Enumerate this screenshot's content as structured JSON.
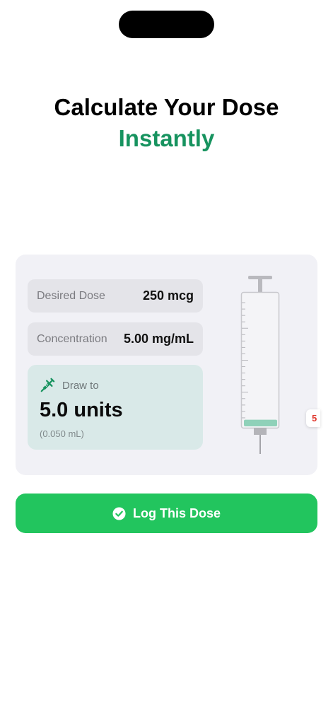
{
  "headline": {
    "line1": "Calculate Your Dose",
    "line2": "Instantly"
  },
  "calculator": {
    "desired_dose": {
      "label": "Desired Dose",
      "value": "250 mcg"
    },
    "concentration": {
      "label": "Concentration",
      "value": "5.00 mg/mL"
    },
    "result": {
      "icon": "syringe-icon",
      "label": "Draw to",
      "units": "5.0 units",
      "volume": "(0.050 mL)"
    },
    "syringe_fill_fraction": 0.05
  },
  "edge_badge": "5",
  "action": {
    "label": "Log This Dose",
    "icon": "checkmark-circle-icon"
  },
  "colors": {
    "accent": "#17935f",
    "button": "#22c55e",
    "result_bg": "#d9e9e8",
    "syringe_fill": "#8fd1b9"
  }
}
